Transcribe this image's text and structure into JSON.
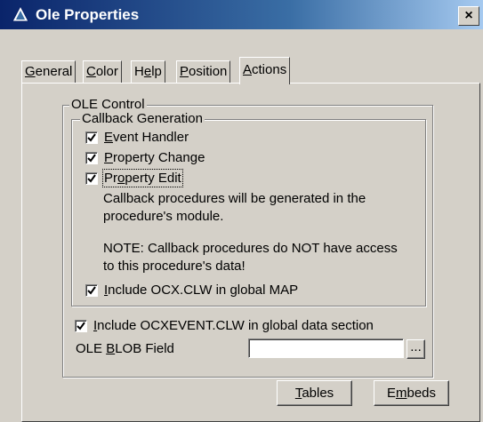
{
  "window": {
    "title": "Ole Properties",
    "close_label": "×"
  },
  "tabs": [
    {
      "pre": "",
      "key": "G",
      "post": "eneral"
    },
    {
      "pre": "",
      "key": "C",
      "post": "olor"
    },
    {
      "pre": "H",
      "key": "e",
      "post": "lp"
    },
    {
      "pre": "",
      "key": "P",
      "post": "osition"
    },
    {
      "pre": "",
      "key": "A",
      "post": "ctions"
    }
  ],
  "active_tab": "Actions",
  "ole_control": {
    "label": "OLE Control",
    "callback_generation": {
      "label": "Callback Generation",
      "event_handler": {
        "pre": "",
        "key": "E",
        "post": "vent Handler",
        "checked": true
      },
      "property_change": {
        "pre": "",
        "key": "P",
        "post": "roperty Change",
        "checked": true
      },
      "property_edit": {
        "pre": "Pr",
        "key": "o",
        "post": "perty Edit",
        "checked": true
      },
      "note1_line1": "Callback procedures will be generated in the",
      "note1_line2": "procedure's module.",
      "note2_line1": "NOTE: Callback procedures do NOT have access",
      "note2_line2": "to this procedure's data!",
      "include_ocx": {
        "pre": "",
        "key": "I",
        "post": "nclude OCX.CLW in global MAP",
        "checked": true
      }
    }
  },
  "include_ocxevent": {
    "pre": "",
    "key": "I",
    "post": "nclude OCXEVENT.CLW in global data section",
    "checked": true
  },
  "blob_field": {
    "label_pre": "OLE ",
    "label_key": "B",
    "label_post": "LOB Field",
    "value": "",
    "browse_label": "..."
  },
  "buttons": {
    "tables": {
      "pre": "",
      "key": "T",
      "post": "ables"
    },
    "embeds": {
      "pre": "E",
      "key": "m",
      "post": "beds"
    }
  }
}
